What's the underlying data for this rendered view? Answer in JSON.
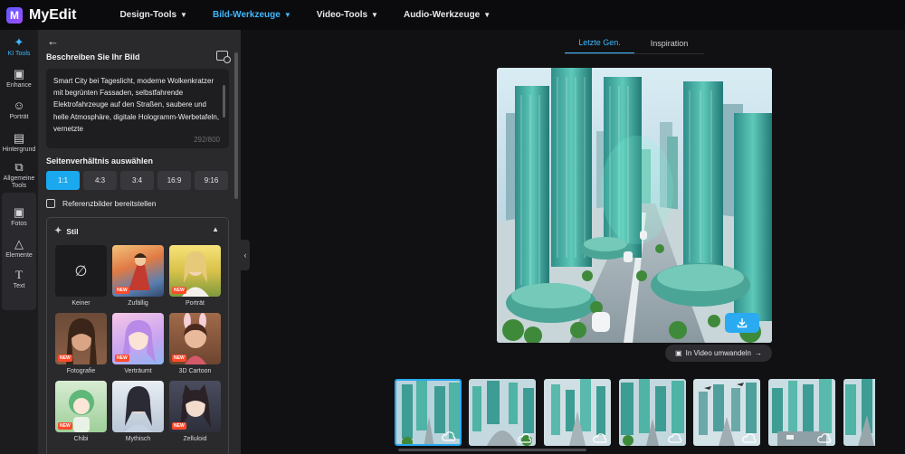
{
  "app": {
    "name": "MyEdit",
    "logo_letter": "M"
  },
  "nav": [
    {
      "label": "Design-Tools",
      "active": false
    },
    {
      "label": "Bild-Werkzeuge",
      "active": true
    },
    {
      "label": "Video-Tools",
      "active": false
    },
    {
      "label": "Audio-Werkzeuge",
      "active": false
    }
  ],
  "rail": {
    "ki_tools": "KI Tools",
    "enhance": "Enhance",
    "portraet": "Porträt",
    "hintergrund": "Hintergrund",
    "allgemeine": "Allgemeine Tools",
    "fotos": "Fotos",
    "elemente": "Elemente",
    "text": "Text"
  },
  "panel": {
    "describe_title": "Beschreiben Sie Ihr Bild",
    "prompt_text": "Smart City bei Tageslicht, moderne Wolkenkratzer mit begrünten Fassaden, selbstfahrende Elektrofahrzeuge auf den Straßen, saubere und helle Atmosphäre, digitale Hologramm-Werbetafeln, vernetzte",
    "char_count": "292/800",
    "ratio_title": "Seitenverhältnis auswählen",
    "ratios": [
      "1:1",
      "4:3",
      "3:4",
      "16:9",
      "9:16"
    ],
    "selected_ratio": "1:1",
    "reference_label": "Referenzbilder bereitstellen",
    "style_title": "Stil",
    "badge_new": "NEW",
    "styles": [
      {
        "label": "Keiner",
        "new": false
      },
      {
        "label": "Zufällig",
        "new": true
      },
      {
        "label": "Porträt",
        "new": true
      },
      {
        "label": "Fotografie",
        "new": true
      },
      {
        "label": "Verträumt",
        "new": true
      },
      {
        "label": "3D Cartoon",
        "new": true
      },
      {
        "label": "Chibi",
        "new": true
      },
      {
        "label": "Mythisch",
        "new": false
      },
      {
        "label": "Zelluloid",
        "new": true
      }
    ]
  },
  "main": {
    "tabs": [
      "Letzte Gen.",
      "Inspiration"
    ],
    "active_tab": "Letzte Gen.",
    "video_button": "In Video umwandeln",
    "thumbnail_count": 7,
    "accent_color": "#2aaaf0"
  }
}
